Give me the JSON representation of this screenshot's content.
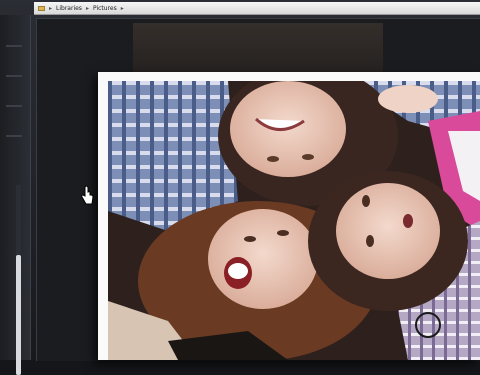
{
  "address_bar": {
    "crumbs": [
      "Libraries",
      "Pictures"
    ],
    "separator": "▸"
  },
  "viewer": {
    "icons": {
      "folder": "folder-icon",
      "cursor": "hand-pointer-icon"
    }
  },
  "colors": {
    "background": "#14161a",
    "frame": "#fafafa",
    "scroll_thumb": "#d8dadf"
  }
}
